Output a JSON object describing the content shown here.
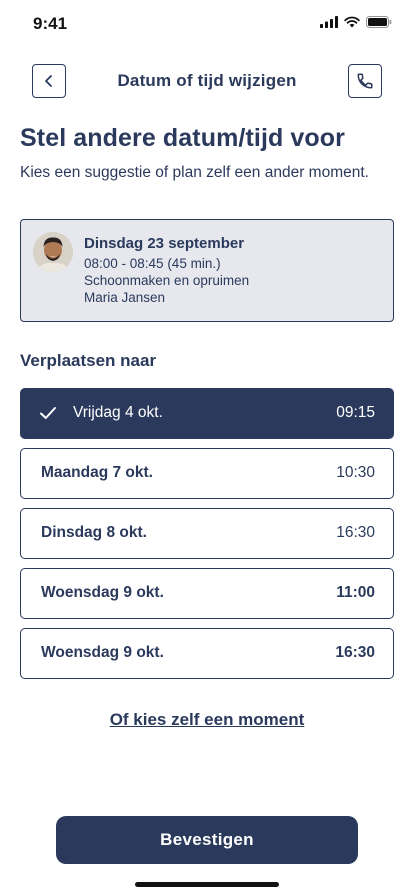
{
  "status_bar": {
    "time": "9:41"
  },
  "nav": {
    "title": "Datum of tijd wijzigen",
    "back_icon": "chevron-left-icon",
    "phone_icon": "phone-icon"
  },
  "heading": "Stel andere datum/tijd voor",
  "subtext": "Kies een suggestie of plan zelf een ander moment.",
  "appointment": {
    "date": "Dinsdag 23 september",
    "time": "08:00 - 08:45 (45 min.)",
    "service": "Schoonmaken en opruimen",
    "worker": "Maria Jansen"
  },
  "section_label": "Verplaatsen naar",
  "slots": [
    {
      "day": "Vrijdag 4 okt.",
      "time": "09:15",
      "selected": true
    },
    {
      "day": "Maandag 7 okt.",
      "time": "10:30",
      "selected": false
    },
    {
      "day": "Dinsdag 8 okt.",
      "time": "16:30",
      "selected": false
    },
    {
      "day": "Woensdag 9 okt.",
      "time": "11:00",
      "selected": false
    },
    {
      "day": "Woensdag 9 okt.",
      "time": "16:30",
      "selected": false
    }
  ],
  "custom_link": "Of kies zelf een moment",
  "confirm_label": "Bevestigen",
  "colors": {
    "primary": "#2b3a5c",
    "card_bg": "#e6e8ee",
    "background": "#ffffff"
  }
}
